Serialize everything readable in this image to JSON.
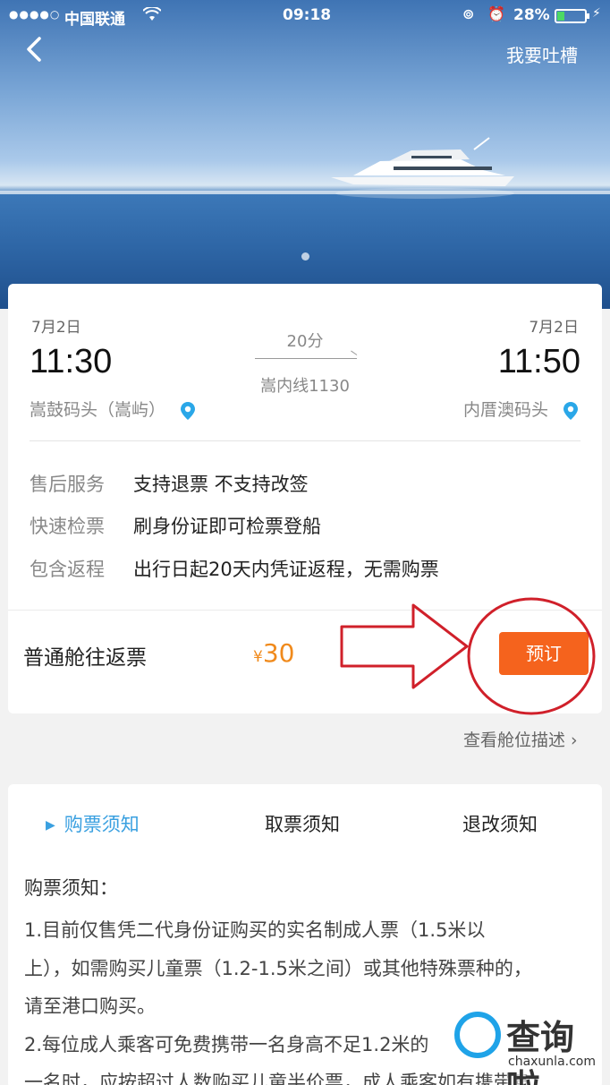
{
  "status_bar": {
    "signal": "●●●●○",
    "carrier": "中国联通",
    "time": "09:18",
    "battery": "28%",
    "battery_level": 0.28
  },
  "header": {
    "back_icon": "chevron-left-icon",
    "feedback_label": "我要吐槽"
  },
  "trip": {
    "depart_date": "7月2日",
    "arrive_date": "7月2日",
    "depart_time": "11:30",
    "arrive_time": "11:50",
    "duration": "20分",
    "route": "嵩内线1130",
    "depart_port": "嵩鼓码头（嵩屿）",
    "arrive_port": "内厝澳码头",
    "location_icon": "location-pin-icon"
  },
  "info_rows": [
    {
      "label": "售后服务",
      "value": "支持退票 不支持改签"
    },
    {
      "label": "快速检票",
      "value": "刷身份证即可检票登船"
    },
    {
      "label": "包含返程",
      "value": "出行日起20天内凭证返程，无需购票"
    }
  ],
  "fare": {
    "name": "普通舱往返票",
    "currency": "¥",
    "price": "30",
    "book_label": "预订"
  },
  "cabin_link": "查看舱位描述 ›",
  "notice": {
    "tabs": [
      "购票须知",
      "取票须知",
      "退改须知"
    ],
    "title": "购票须知：",
    "lines": [
      "1.目前仅售凭二代身份证购买的实名制成人票（1.5米以",
      "上），如需购买儿童票（1.2-1.5米之间）或其他特殊票种的，",
      "请至港口购买。",
      "2.每位成人乘客可免费携带一名身高不足1.2米的",
      "一名时，应按超过人数购买儿童半价票，成人乘客如有携带身"
    ]
  },
  "watermark": {
    "text": "查询啦",
    "url": "chaxunla.com"
  },
  "colors": {
    "accent_blue": "#3aa0e0",
    "price_orange": "#f08a1c",
    "button_orange": "#f5631d",
    "annotation_red": "#d0202a"
  }
}
